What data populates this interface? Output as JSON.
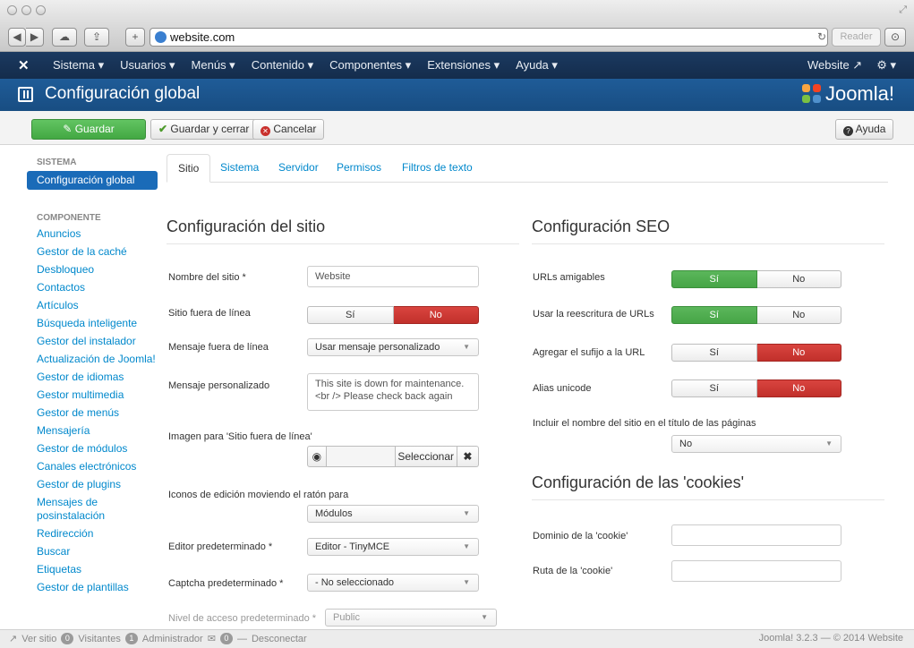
{
  "browser": {
    "url": "website.com",
    "reader_label": "Reader",
    "nav_glyphs": {
      "back": "◀",
      "forward": "▶",
      "cloud": "☁",
      "share": "⇪",
      "newtab": "+"
    },
    "reload_glyph": "↻",
    "download_glyph": "⊙",
    "resize_glyph": "⤢"
  },
  "navbar": {
    "logo_glyph": "✕",
    "items": [
      "Sistema ▾",
      "Usuarios ▾",
      "Menús ▾",
      "Contenido ▾",
      "Componentes ▾",
      "Extensiones ▾",
      "Ayuda ▾"
    ],
    "website_link": "Website ↗",
    "gear": "⚙ ▾"
  },
  "header": {
    "title": "Configuración global",
    "brand": "Joomla!"
  },
  "toolbar": {
    "save_label": "Guardar",
    "save_icon": "✎",
    "save_close_label": "Guardar y cerrar",
    "save_close_icon": "✔",
    "cancel_label": "Cancelar",
    "cancel_icon": "✕",
    "help_label": "Ayuda",
    "help_icon": "?"
  },
  "sidebar": {
    "system_heading": "SISTEMA",
    "active_item": "Configuración global",
    "component_heading": "COMPONENTE",
    "items": [
      "Anuncios",
      "Gestor de la caché",
      "Desbloqueo",
      "Contactos",
      "Artículos",
      "Búsqueda inteligente",
      "Gestor del instalador",
      "Actualización de Joomla!",
      "Gestor de idiomas",
      "Gestor multimedia",
      "Gestor de menús",
      "Mensajería",
      "Gestor de módulos",
      "Canales electrónicos",
      "Gestor de plugins",
      "Mensajes de posinstalación",
      "Redirección",
      "Buscar",
      "Etiquetas",
      "Gestor de plantillas"
    ]
  },
  "tabs": [
    "Sitio",
    "Sistema",
    "Servidor",
    "Permisos",
    "Filtros de texto"
  ],
  "site": {
    "section_title": "Configuración del sitio",
    "site_name_label": "Nombre del sitio *",
    "site_name_value": "Website",
    "offline_label": "Sitio fuera de línea",
    "offline_yes": "Sí",
    "offline_no": "No",
    "offline_message_label": "Mensaje fuera de línea",
    "offline_message_value": "Usar mensaje personalizado",
    "custom_message_label": "Mensaje personalizado",
    "custom_message_line1": "This site is down for maintenance.",
    "custom_message_line2": "<br /> Please check back again",
    "offline_image_label": "Imagen para 'Sitio fuera de línea'",
    "preview_icon": "◉",
    "select_label": "Seleccionar",
    "clear_icon": "✖",
    "edit_icons_label": "Iconos de edición moviendo el ratón para",
    "edit_icons_value": "Módulos",
    "editor_label": "Editor predeterminado *",
    "editor_value": "Editor - TinyMCE",
    "captcha_label": "Captcha predeterminado *",
    "captcha_value": "- No seleccionado",
    "access_label": "Nivel de acceso predeterminado *",
    "access_value": "Public",
    "caret": "▼"
  },
  "seo": {
    "section_title": "Configuración SEO",
    "sef_label": "URLs amigables",
    "rewrite_label": "Usar la reescritura de URLs",
    "suffix_label": "Agregar el sufijo a la URL",
    "unicode_label": "Alias unicode",
    "yes": "Sí",
    "no": "No",
    "sitename_pagetitles_label": "Incluir el nombre del sitio en el título de las páginas",
    "sitename_pagetitles_value": "No"
  },
  "cookies": {
    "section_title": "Configuración de las 'cookies'",
    "domain_label": "Dominio de la 'cookie'",
    "path_label": "Ruta de la 'cookie'"
  },
  "footer": {
    "view_site": "Ver sitio",
    "visitors_count": "0",
    "visitors_label": "Visitantes",
    "admins_count": "1",
    "admins_label": "Administrador",
    "messages_count": "0",
    "logout_label": "Desconectar",
    "version": "Joomla! 3.2.3 — © 2014 Website"
  },
  "colors": {
    "navbar": "#1b3a60",
    "header": "#1f5c98",
    "success": "#46a546",
    "danger": "#c1302b",
    "link": "#0088cc"
  }
}
